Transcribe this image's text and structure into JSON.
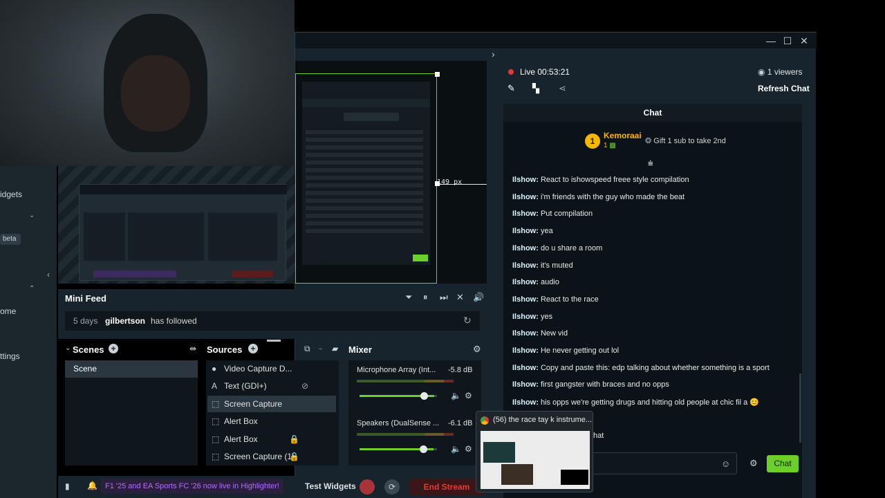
{
  "window": {
    "minimize": "—",
    "maximize": "☐",
    "close": "✕",
    "expand_arrow": "›"
  },
  "live": {
    "status": "Live",
    "time": "00:53:21",
    "viewers": "1 viewers",
    "refresh": "Refresh Chat"
  },
  "chat": {
    "header": "Chat",
    "top_user": "Kemoraai",
    "top_rank": "1",
    "top_sub_count": "1",
    "gift_text": "Gift 1 sub to take 2nd",
    "messages": [
      {
        "user": "Ilshow:",
        "text": "React to ishowspeed freee style compilation"
      },
      {
        "user": "Ilshow:",
        "text": "i'm friends with the guy who made the beat"
      },
      {
        "user": "Ilshow:",
        "text": "Put compilation"
      },
      {
        "user": "Ilshow:",
        "text": "yea"
      },
      {
        "user": "Ilshow:",
        "text": "do u share a room"
      },
      {
        "user": "Ilshow:",
        "text": "it's muted"
      },
      {
        "user": "Ilshow:",
        "text": "audio"
      },
      {
        "user": "Ilshow:",
        "text": "React to the race"
      },
      {
        "user": "Ilshow:",
        "text": "yes"
      },
      {
        "user": "Ilshow:",
        "text": "New vid"
      },
      {
        "user": "Ilshow:",
        "text": "He never getting out lol"
      },
      {
        "user": "Ilshow:",
        "text": "Copy and paste this: edp talking about whether something is a sport"
      },
      {
        "user": "Ilshow:",
        "text": "first gangster with braces and no opps"
      },
      {
        "user": "Ilshow:",
        "text": "his opps we're getting drugs and hitting old people at chic fil a 😊"
      }
    ],
    "partial_text": "hat",
    "send": "Chat"
  },
  "sidebar": {
    "widgets": "idgets",
    "beta": "beta",
    "home": "ome",
    "settings": "ttings"
  },
  "preview": {
    "measure": "149 px"
  },
  "minifeed": {
    "title": "Mini Feed",
    "time": "5 days",
    "user": "gilbertson",
    "action": "has followed"
  },
  "scenes": {
    "title": "Scenes",
    "items": [
      "Scene"
    ]
  },
  "sources": {
    "title": "Sources",
    "items": [
      {
        "label": "Video Capture D...",
        "icon": "camera-icon"
      },
      {
        "label": "Text (GDI+)",
        "icon": "text-icon"
      },
      {
        "label": "Screen Capture",
        "icon": "screen-icon"
      },
      {
        "label": "Alert Box",
        "icon": "alert-icon"
      },
      {
        "label": "Alert Box",
        "icon": "alert-icon"
      },
      {
        "label": "Screen Capture (1)",
        "icon": "screen-icon"
      }
    ]
  },
  "mixer": {
    "title": "Mixer",
    "channels": [
      {
        "name": "Microphone Array (Int...",
        "level": "-5.8 dB",
        "volume": 0.85
      },
      {
        "name": "Speakers (DualSense ...",
        "level": "-6.1 dB",
        "volume": 0.84
      }
    ]
  },
  "bottom": {
    "promo": "F1 '25 and EA Sports FC '26 now live in Highlighter!",
    "test_widgets": "Test Widgets",
    "end_stream": "End Stream"
  },
  "tooltip": {
    "text": "(56) the race tay k instrume..."
  },
  "colors": {
    "accent": "#6bd02b",
    "live_dot": "#e53935",
    "end_stream": "#e53935",
    "promo": "#b46cff"
  }
}
